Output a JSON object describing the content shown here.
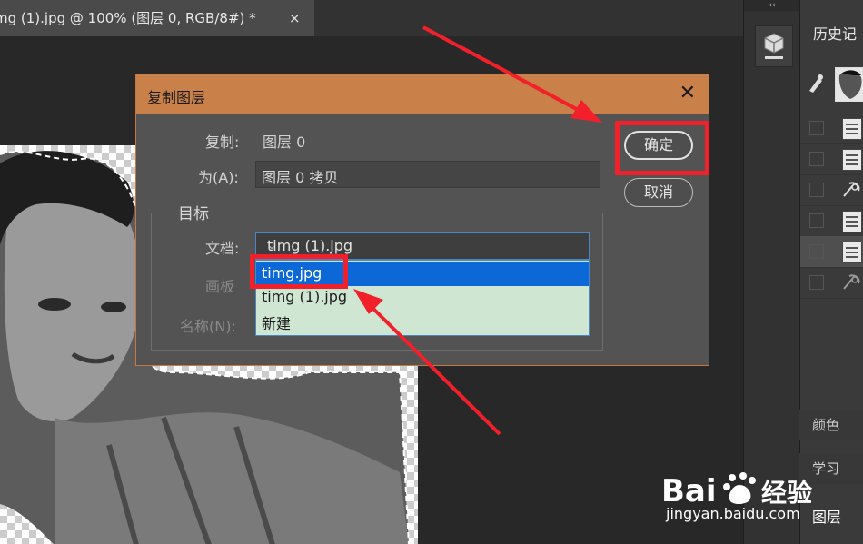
{
  "document": {
    "tab_title": "mg (1).jpg @ 100% (图层 0, RGB/8#) *",
    "tab_close": "×"
  },
  "right_panel": {
    "collapse_glyph": "‹‹",
    "history_title": "历史记",
    "color_label": "颜色",
    "learn_label": "学习",
    "layers_label": "图层"
  },
  "dialog": {
    "title": "复制图层",
    "close_glyph": "✕",
    "duplicate_label": "复制:",
    "duplicate_value": "图层 0",
    "as_label": "为(A):",
    "as_value": "图层 0 拷贝",
    "target_group": "目标",
    "document_label": "文档:",
    "document_value": "timg (1).jpg",
    "artboard_label": "画板",
    "name_label": "名称(N):",
    "document_options": [
      "timg.jpg",
      "timg (1).jpg",
      "新建"
    ],
    "ok_label": "确定",
    "cancel_label": "取消"
  },
  "watermark": {
    "logo_text": "Bai 经验",
    "url": "jingyan.baidu.com"
  },
  "colors": {
    "dialog_title_bar": "#c98049",
    "highlight": "#0b68d6",
    "annotation_red": "#f2202a"
  }
}
